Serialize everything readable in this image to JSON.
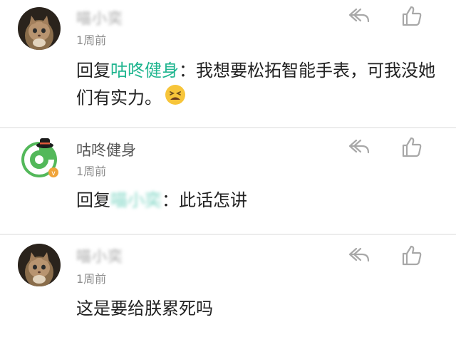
{
  "comments": [
    {
      "username": "喵小奕",
      "time": "1周前",
      "reply_prefix": "回复",
      "mention": "咕咚健身",
      "text": "：我想要松拓智能手表，可我没她们有实力。",
      "emoji": "tired-face-emoji",
      "avatar": "cat-avatar"
    },
    {
      "username": "咕咚健身",
      "time": "1周前",
      "reply_prefix": "回复",
      "mention": "喵小奕",
      "text": "：此话怎讲",
      "avatar": "codoon-logo-avatar",
      "badge": "v"
    },
    {
      "username": "喵小奕",
      "time": "1周前",
      "text": "这是要给朕累死吗",
      "avatar": "cat-avatar"
    }
  ],
  "icons": {
    "reply": "reply-arrow-icon",
    "like": "thumbs-up-icon"
  },
  "colors": {
    "mention": "#1fb58f",
    "codoon_green": "#53b85a",
    "badge": "#f0a43a",
    "muted": "#8e8e8e"
  }
}
